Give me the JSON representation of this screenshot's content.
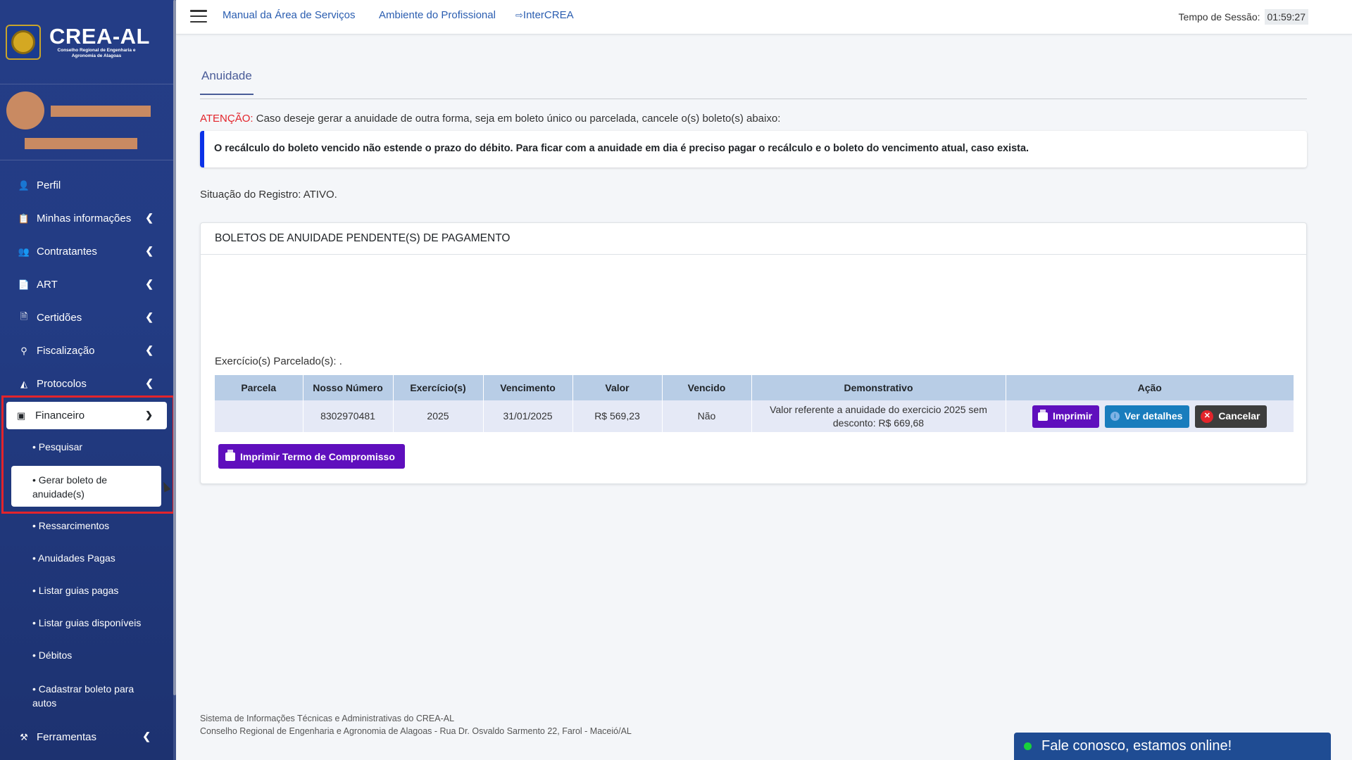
{
  "brand": {
    "name": "CREA-AL",
    "subtitle": "Conselho Regional de Engenharia e Agronomia de Alagoas"
  },
  "sidebar": {
    "items": [
      {
        "label": "Perfil",
        "icon": "user-icon"
      },
      {
        "label": "Minhas informações",
        "icon": "clipboard-icon"
      },
      {
        "label": "Contratantes",
        "icon": "users-icon"
      },
      {
        "label": "ART",
        "icon": "document-icon"
      },
      {
        "label": "Certidões",
        "icon": "file-icon"
      },
      {
        "label": "Fiscalização",
        "icon": "search-icon"
      },
      {
        "label": "Protocolos",
        "icon": "inbox-icon"
      }
    ],
    "financeiro": {
      "label": "Financeiro",
      "subitems": [
        "• Pesquisar",
        "• Gerar boleto de anuidade(s)",
        "• Ressarcimentos",
        "• Anuidades Pagas",
        "• Listar guias pagas",
        "• Listar guias disponíveis",
        "• Débitos",
        "• Cadastrar boleto para autos"
      ]
    },
    "ferramentas": {
      "label": "Ferramentas",
      "icon": "tools-icon"
    }
  },
  "topbar": {
    "links": [
      "Manual da Área de Serviços",
      "Ambiente do Profissional",
      "InterCREA"
    ],
    "session_label": "Tempo de Sessão:",
    "session_time": "01:59:27"
  },
  "page": {
    "tab": "Anuidade",
    "attention_prefix": "ATENÇÃO:",
    "attention_text": " Caso deseje gerar a anuidade de outra forma, seja em boleto único ou parcelada, cancele o(s) boleto(s) abaixo:",
    "info": "O recálculo do boleto vencido não estende o prazo do débito. Para ficar com a anuidade em dia é preciso pagar o recálculo e o boleto do vencimento atual, caso exista.",
    "situacao": "Situação do Registro: ATIVO."
  },
  "card": {
    "title": "BOLETOS DE ANUIDADE PENDENTE(S) DE PAGAMENTO",
    "parcelado": "Exercício(s) Parcelado(s): .",
    "columns": [
      "Parcela",
      "Nosso Número",
      "Exercício(s)",
      "Vencimento",
      "Valor",
      "Vencido",
      "Demonstrativo",
      "Ação"
    ],
    "rows": [
      {
        "parcela": "",
        "nosso_numero": "8302970481",
        "exercicio": "2025",
        "vencimento": "31/01/2025",
        "valor": "R$ 569,23",
        "vencido": "Não",
        "demonstrativo": "Valor referente a anuidade do exercicio 2025 sem desconto: R$ 669,68"
      }
    ],
    "actions": {
      "print": "Imprimir",
      "details": "Ver detalhes",
      "cancel": "Cancelar"
    },
    "termo_button": "Imprimir Termo de Compromisso"
  },
  "footer": {
    "line1": "Sistema de Informações Técnicas e Administrativas do CREA-AL",
    "line2": "Conselho Regional de Engenharia e Agronomia de Alagoas - Rua Dr. Osvaldo Sarmento 22, Farol - Maceió/AL"
  },
  "chat": {
    "label": "Fale conosco, estamos online!"
  },
  "colors": {
    "sidebar": "#233c84",
    "accent": "#5f0fbd",
    "info_border": "#0b32e8",
    "highlight": "#e3242b"
  }
}
